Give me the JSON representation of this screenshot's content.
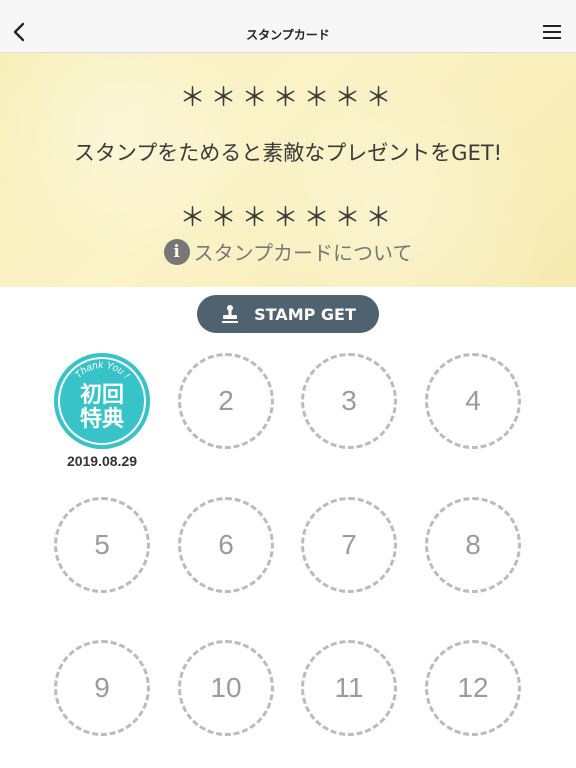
{
  "header": {
    "title": "スタンプカード",
    "back_icon": "chevron-left-icon",
    "menu_icon": "hamburger-menu-icon"
  },
  "banner": {
    "stars_top": "＊＊＊＊＊＊＊",
    "tagline": "スタンプをためると素敵なプレゼントをGET!",
    "stars_bottom": "＊＊＊＊＊＊＊",
    "info_label": "スタンプカードについて",
    "info_icon": "info-icon"
  },
  "stamp_button": {
    "label": "STAMP GET",
    "icon": "stamp-icon"
  },
  "first_stamp": {
    "arc_text": "Thank You !",
    "line1": "初回",
    "line2": "特典",
    "date": "2019.08.29"
  },
  "slots": [
    "2",
    "3",
    "4",
    "5",
    "6",
    "7",
    "8",
    "9",
    "10",
    "11",
    "12"
  ],
  "colors": {
    "banner": "#f7efb8",
    "button": "#4f6270",
    "stamp": "#37c3c7",
    "slot_border": "#bbbbbb"
  }
}
